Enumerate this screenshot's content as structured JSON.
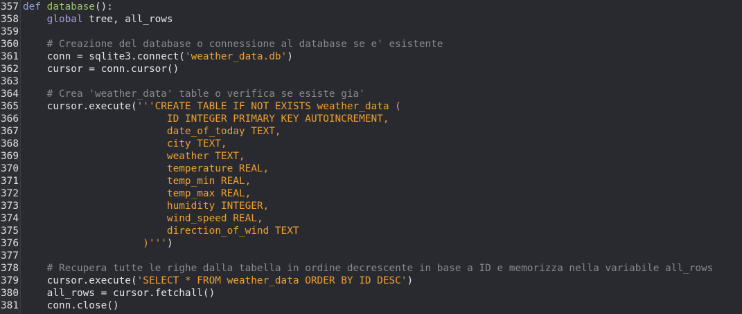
{
  "editor": {
    "lines": [
      {
        "num": "357",
        "tokens": [
          {
            "t": "kw",
            "v": "def "
          },
          {
            "t": "fn",
            "v": "database"
          },
          {
            "t": "text",
            "v": "():"
          }
        ]
      },
      {
        "num": "358",
        "tokens": [
          {
            "t": "text",
            "v": "    "
          },
          {
            "t": "global",
            "v": "global"
          },
          {
            "t": "text",
            "v": " tree, all_rows"
          }
        ]
      },
      {
        "num": "359",
        "tokens": []
      },
      {
        "num": "360",
        "tokens": [
          {
            "t": "text",
            "v": "    "
          },
          {
            "t": "comment",
            "v": "# Creazione del database o connessione al database se e' esistente"
          }
        ]
      },
      {
        "num": "361",
        "tokens": [
          {
            "t": "text",
            "v": "    conn = sqlite3.connect("
          },
          {
            "t": "string",
            "v": "'weather_data.db'"
          },
          {
            "t": "text",
            "v": ")"
          }
        ]
      },
      {
        "num": "362",
        "tokens": [
          {
            "t": "text",
            "v": "    cursor = conn.cursor()"
          }
        ]
      },
      {
        "num": "363",
        "tokens": []
      },
      {
        "num": "364",
        "tokens": [
          {
            "t": "text",
            "v": "    "
          },
          {
            "t": "comment",
            "v": "# Crea 'weather_data' table o verifica se esiste gia'"
          }
        ]
      },
      {
        "num": "365",
        "tokens": [
          {
            "t": "text",
            "v": "    cursor.execute("
          },
          {
            "t": "string",
            "v": "'''CREATE TABLE IF NOT EXISTS weather_data ("
          }
        ]
      },
      {
        "num": "366",
        "tokens": [
          {
            "t": "string",
            "v": "                        ID INTEGER PRIMARY KEY AUTOINCREMENT,"
          }
        ]
      },
      {
        "num": "367",
        "tokens": [
          {
            "t": "string",
            "v": "                        date_of_today TEXT,"
          }
        ]
      },
      {
        "num": "368",
        "tokens": [
          {
            "t": "string",
            "v": "                        city TEXT,"
          }
        ]
      },
      {
        "num": "369",
        "tokens": [
          {
            "t": "string",
            "v": "                        weather TEXT,"
          }
        ]
      },
      {
        "num": "370",
        "tokens": [
          {
            "t": "string",
            "v": "                        temperature REAL,"
          }
        ]
      },
      {
        "num": "371",
        "tokens": [
          {
            "t": "string",
            "v": "                        temp_min REAL,"
          }
        ]
      },
      {
        "num": "372",
        "tokens": [
          {
            "t": "string",
            "v": "                        temp_max REAL,"
          }
        ]
      },
      {
        "num": "373",
        "tokens": [
          {
            "t": "string",
            "v": "                        humidity INTEGER,"
          }
        ]
      },
      {
        "num": "374",
        "tokens": [
          {
            "t": "string",
            "v": "                        wind_speed REAL,"
          }
        ]
      },
      {
        "num": "375",
        "tokens": [
          {
            "t": "string",
            "v": "                        direction_of_wind TEXT"
          }
        ]
      },
      {
        "num": "376",
        "tokens": [
          {
            "t": "string",
            "v": "                    )'''"
          },
          {
            "t": "text",
            "v": ")"
          }
        ]
      },
      {
        "num": "377",
        "tokens": []
      },
      {
        "num": "378",
        "tokens": [
          {
            "t": "text",
            "v": "    "
          },
          {
            "t": "comment",
            "v": "# Recupera tutte le righe dalla tabella in ordine decrescente in base a ID e memorizza nella variabile all_rows"
          }
        ]
      },
      {
        "num": "379",
        "tokens": [
          {
            "t": "text",
            "v": "    cursor.execute("
          },
          {
            "t": "string",
            "v": "'SELECT * FROM weather_data ORDER BY ID DESC'"
          },
          {
            "t": "text",
            "v": ")"
          }
        ]
      },
      {
        "num": "380",
        "tokens": [
          {
            "t": "text",
            "v": "    all_rows = cursor.fetchall()"
          }
        ]
      },
      {
        "num": "381",
        "tokens": [
          {
            "t": "text",
            "v": "    conn.close()"
          }
        ]
      }
    ]
  },
  "colors": {
    "background": "#292a2f",
    "keyword": "#8f9ce0",
    "function_name": "#97c470",
    "comment": "#8a8a8a",
    "string": "#f0a030",
    "text": "#e4e4e4"
  }
}
